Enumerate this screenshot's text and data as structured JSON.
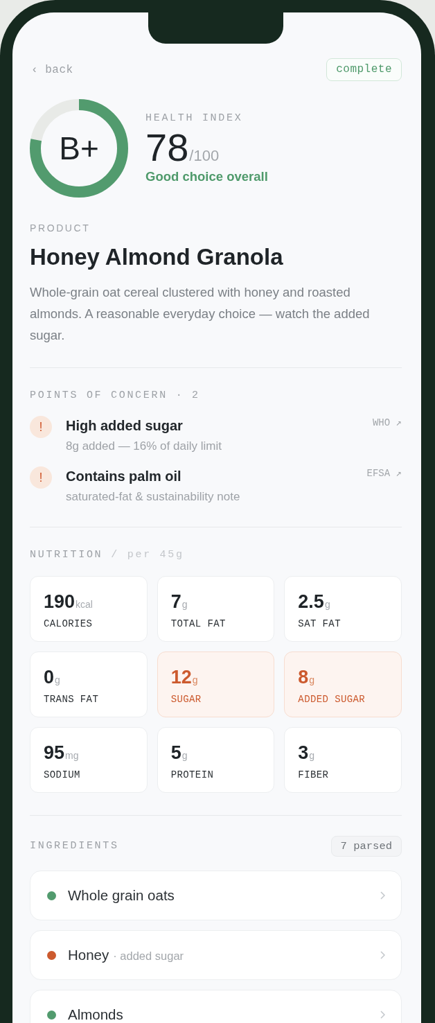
{
  "nav": {
    "back": "‹ back",
    "status": "complete"
  },
  "score": {
    "grade": "B+",
    "level": 0.78,
    "label": "HEALTH INDEX",
    "value": "78",
    "max": "/100",
    "verdict": "Good choice overall"
  },
  "product": {
    "label": "PRODUCT",
    "name": "Honey Almond Granola",
    "description": "Whole-grain oat cereal clustered with honey and roasted almonds. A reasonable everyday choice — watch the added sugar."
  },
  "concerns": {
    "title": "POINTS OF CONCERN · 2",
    "items": [
      {
        "icon": "!",
        "title": "High added sugar",
        "detail": "8g added — 16% of daily limit",
        "source": "WHO ↗"
      },
      {
        "icon": "!",
        "title": "Contains palm oil",
        "detail": "saturated-fat & sustainability note",
        "source": "EFSA ↗"
      }
    ]
  },
  "nutrition": {
    "title": "NUTRITION",
    "basis": "/ per 45g",
    "items": [
      {
        "value": "190",
        "unit": "kcal",
        "label": "CALORIES",
        "flagged": false
      },
      {
        "value": "7",
        "unit": "g",
        "label": "TOTAL FAT",
        "flagged": false
      },
      {
        "value": "2.5",
        "unit": "g",
        "label": "SAT FAT",
        "flagged": false
      },
      {
        "value": "0",
        "unit": "g",
        "label": "TRANS FAT",
        "flagged": false
      },
      {
        "value": "12",
        "unit": "g",
        "label": "SUGAR",
        "flagged": true
      },
      {
        "value": "8",
        "unit": "g",
        "label": "ADDED SUGAR",
        "flagged": true
      },
      {
        "value": "95",
        "unit": "mg",
        "label": "SODIUM",
        "flagged": false
      },
      {
        "value": "5",
        "unit": "g",
        "label": "PROTEIN",
        "flagged": false
      },
      {
        "value": "3",
        "unit": "g",
        "label": "FIBER",
        "flagged": false
      }
    ]
  },
  "ingredients": {
    "title": "INGREDIENTS",
    "count": "7 parsed",
    "items": [
      {
        "name": "Whole grain oats",
        "color": "#529b6e"
      },
      {
        "name": "Honey",
        "note": "· added sugar",
        "color": "#cc5a2e"
      },
      {
        "name": "Almonds",
        "color": "#529b6e"
      }
    ]
  }
}
